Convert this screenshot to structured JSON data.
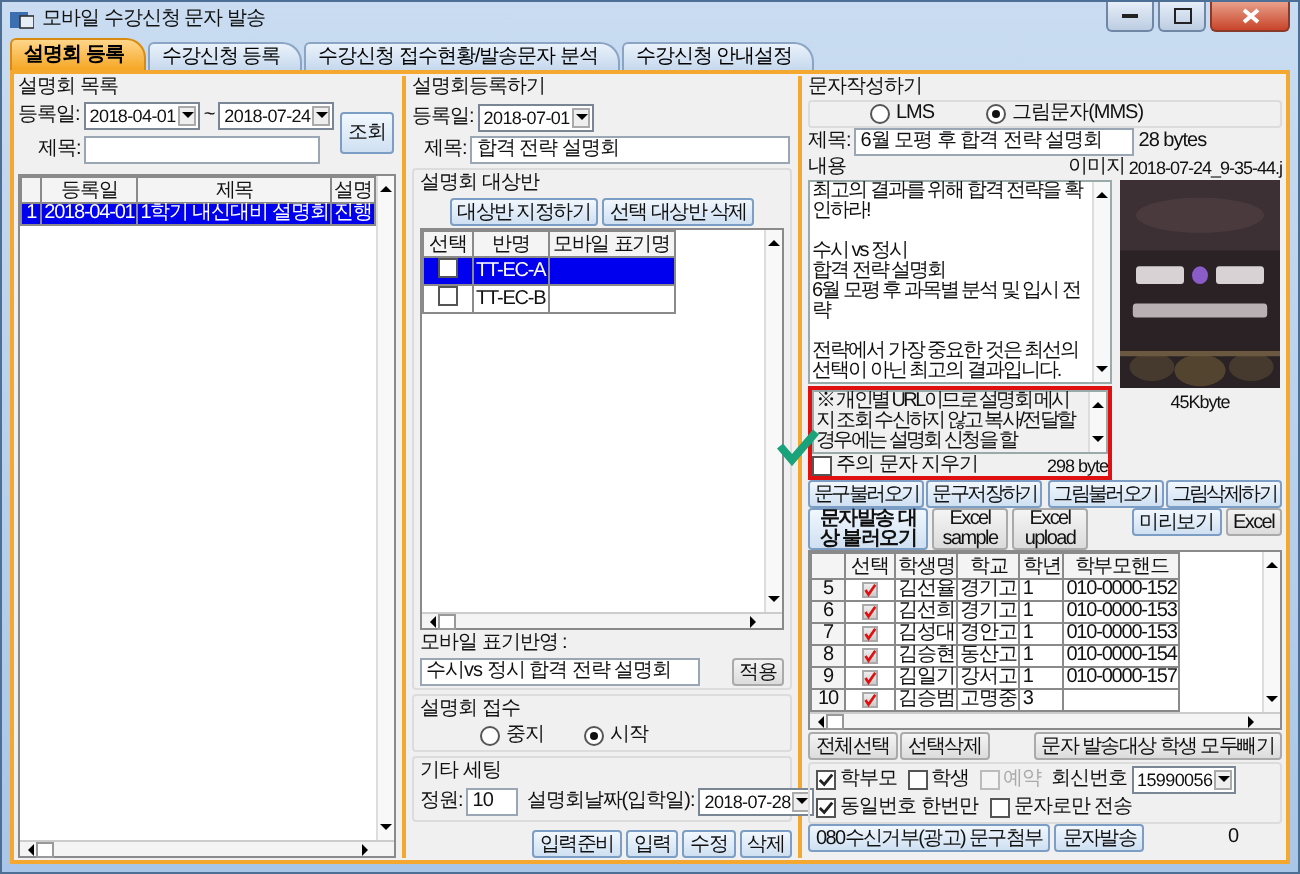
{
  "window": {
    "title": "모바일 수강신청 문자 발송"
  },
  "tabs": [
    {
      "label": "설명회 등록",
      "selected": true
    },
    {
      "label": "수강신청 등록",
      "selected": false
    },
    {
      "label": "수강신청 접수현황/발송문자 분석",
      "selected": false
    },
    {
      "label": "수강신청 안내설정",
      "selected": false
    }
  ],
  "event_list": {
    "title": "설명회 목록",
    "date_label": "등록일:",
    "date_from": "2018-04-01",
    "range_separator": "~",
    "date_to": "2018-07-24",
    "name_label": "제목:",
    "search_button": "조회",
    "columns": [
      "등록일",
      "제목",
      "설명"
    ],
    "rows": [
      {
        "number": "1",
        "cells": [
          "2018-04-01",
          "1학기 내신대비 설명회",
          "진행"
        ],
        "selected": true
      }
    ]
  },
  "event_form": {
    "title": "설명회등록하기",
    "date_label": "등록일:",
    "date": "2018-07-01",
    "name_label": "제목:",
    "name": "합격 전략 설명회",
    "classes": {
      "title": "설명회 대상반",
      "buttons": [
        "대상반 지정하기",
        "선택 대상반 삭제"
      ],
      "check_column": "선택",
      "columns": [
        "반명",
        "모바일 표기명"
      ],
      "rows": [
        {
          "checked": false,
          "cells": [
            "TT-EC-A"
          ],
          "selected": true
        },
        {
          "checked": false,
          "cells": [
            "TT-EC-B"
          ],
          "selected": false
        }
      ]
    },
    "mobile_label": "모바일 표기반영 :",
    "mobile_value": "수시vs 정시 합격 전략 설명회",
    "apply_button": "적용",
    "reception": {
      "title": "설명회 접수",
      "options": [
        {
          "label": "중지",
          "selected": false
        },
        {
          "label": "시작",
          "selected": true
        }
      ]
    },
    "settings": {
      "title": "기타 세팅",
      "capacity_label": "정원:",
      "capacity": "10",
      "date_label": "설명회날짜(입학일):",
      "date": "2018-07-28"
    },
    "buttons": [
      "입력준비",
      "입력",
      "수정",
      "삭제"
    ]
  },
  "message": {
    "title": "문자작성하기",
    "types": [
      {
        "label": "LMS",
        "selected": false
      },
      {
        "label": "그림문자(MMS)",
        "selected": true
      }
    ],
    "subject_label": "제목:",
    "subject": "6월 모평 후 합격 전략 설명회",
    "subject_size": "28 bytes",
    "content_label": "내용",
    "image_label": "이미지",
    "image_file": "2018-07-24_9-35-44.j",
    "body": "최고의 결과를 위해 합격 전략을 확인하라!\n\n수시 vs 정시\n합격 전략 설명회\n6월 모평 후 과목별 분석 및 입시 전략\n\n전략에서 가장 중요한 것은 최선의 선택이 아닌 최고의 결과입니다.",
    "notice": "※ 개인별 URL이므로 설명회 메시지 조회 수신하지 않고 복사/전달할 경우에는 설명회 신청을 할",
    "clear_notice": {
      "label": "주의 문자 지우기",
      "checked": false
    },
    "body_size": "298 byte",
    "image_size": "45Kbyte",
    "text_buttons": [
      "문구불러오기",
      "문구저장하기"
    ],
    "image_buttons": [
      "그림불러오기",
      "그림삭제하기"
    ]
  },
  "recipients": {
    "load_button": "문자발송 대상 불러오기",
    "excel_buttons": [
      "Excel sample",
      "Excel upload"
    ],
    "preview_button": "미리보기",
    "excel_button": "Excel",
    "check_column": "선택",
    "columns": [
      "학생명",
      "학교",
      "학년",
      "학부모핸드"
    ],
    "rows": [
      {
        "number": "5",
        "checked": true,
        "cells": [
          "김선율",
          "경기고",
          "1",
          "010-0000-152"
        ]
      },
      {
        "number": "6",
        "checked": true,
        "cells": [
          "김선희",
          "경기고",
          "1",
          "010-0000-153"
        ]
      },
      {
        "number": "7",
        "checked": true,
        "cells": [
          "김성대",
          "경안고",
          "1",
          "010-0000-153"
        ]
      },
      {
        "number": "8",
        "checked": true,
        "cells": [
          "김승현",
          "동산고",
          "1",
          "010-0000-154"
        ]
      },
      {
        "number": "9",
        "checked": true,
        "cells": [
          "김일기",
          "강서고",
          "1",
          "010-0000-157"
        ]
      },
      {
        "number": "10",
        "checked": true,
        "cells": [
          "김승범",
          "고명중",
          "3"
        ]
      }
    ],
    "select_all_button": "전체선택",
    "delete_selected_button": "선택삭제",
    "remove_all_button": "문자 발송대상 학생 모두빼기",
    "options": [
      {
        "label": "학부모",
        "checked": true,
        "disabled": false
      },
      {
        "label": "학생",
        "checked": false,
        "disabled": false
      },
      {
        "label": "예약",
        "checked": false,
        "disabled": true
      }
    ],
    "reply_label": "회신번호",
    "reply_number": "15990056",
    "send_options": [
      {
        "label": "동일번호 한번만",
        "checked": true
      },
      {
        "label": "문자로만 전송",
        "checked": false
      }
    ],
    "optout_button": "080수신거부(광고) 문구첨부",
    "send_button": "문자발송",
    "sent_count": "0"
  }
}
